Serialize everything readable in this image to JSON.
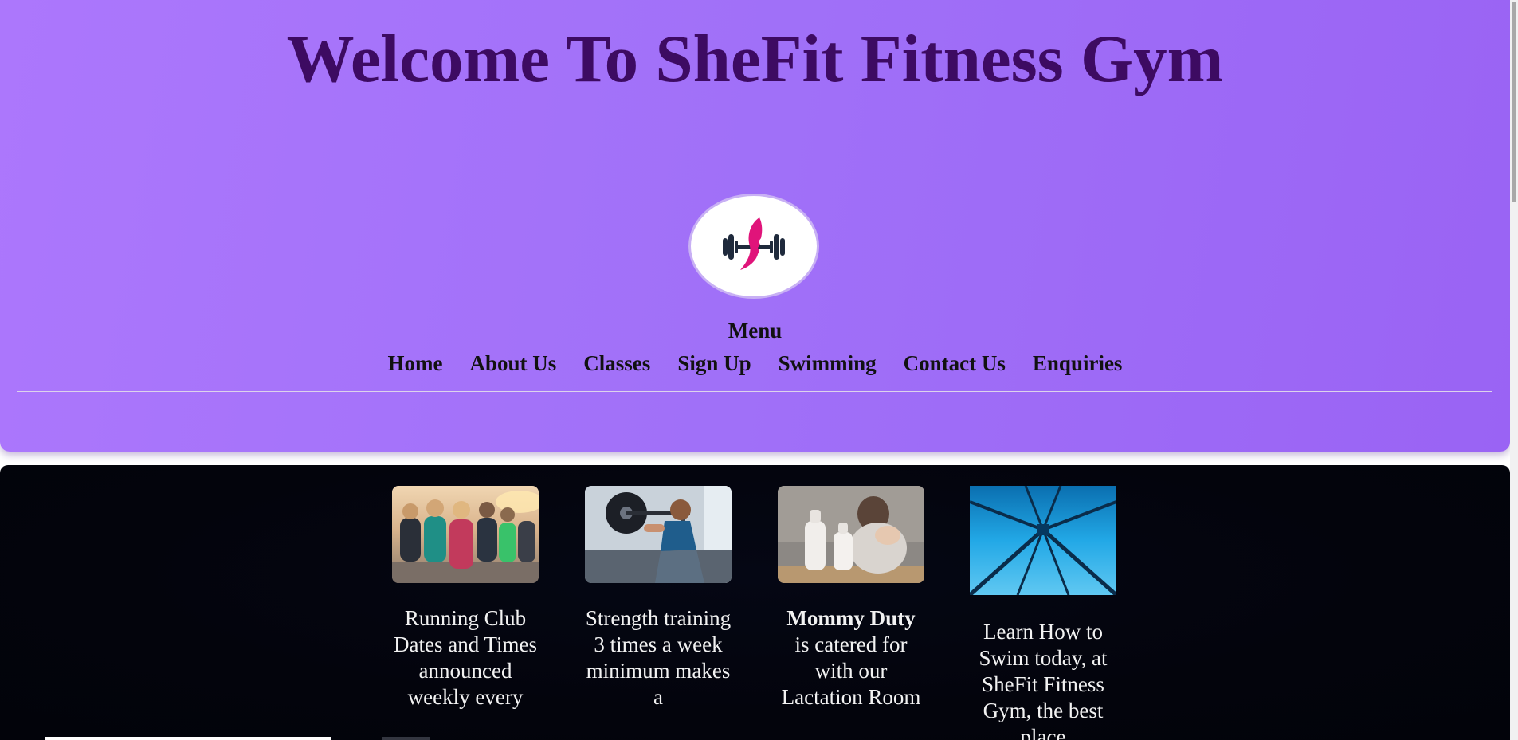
{
  "header": {
    "title": "Welcome To SheFit Fitness Gym",
    "logo_icon": "dumbbell-woman-logo-icon",
    "menu_heading": "Menu",
    "nav": [
      "Home",
      "About Us",
      "Classes",
      "Sign Up",
      "Swimming",
      "Contact Us",
      "Enquiries"
    ]
  },
  "cards": [
    {
      "image_icon": "running-club-photo",
      "text": "Running Club Dates and Times announced weekly every"
    },
    {
      "image_icon": "strength-training-photo",
      "text": "Strength training 3 times a week minimum makes a"
    },
    {
      "image_icon": "lactation-room-photo",
      "bold": "Mommy Duty",
      "text": "is catered for with our Lactation Room"
    },
    {
      "image_icon": "swimming-pool-photo",
      "text": "Learn How to Swim today, at SheFit Fitness Gym, the best place"
    }
  ],
  "colors": {
    "header_bg": "#a070f8",
    "title": "#3d0b62",
    "content_bg": "#03040c",
    "logo_pink": "#e0147a",
    "logo_dark": "#1f2a3c"
  }
}
